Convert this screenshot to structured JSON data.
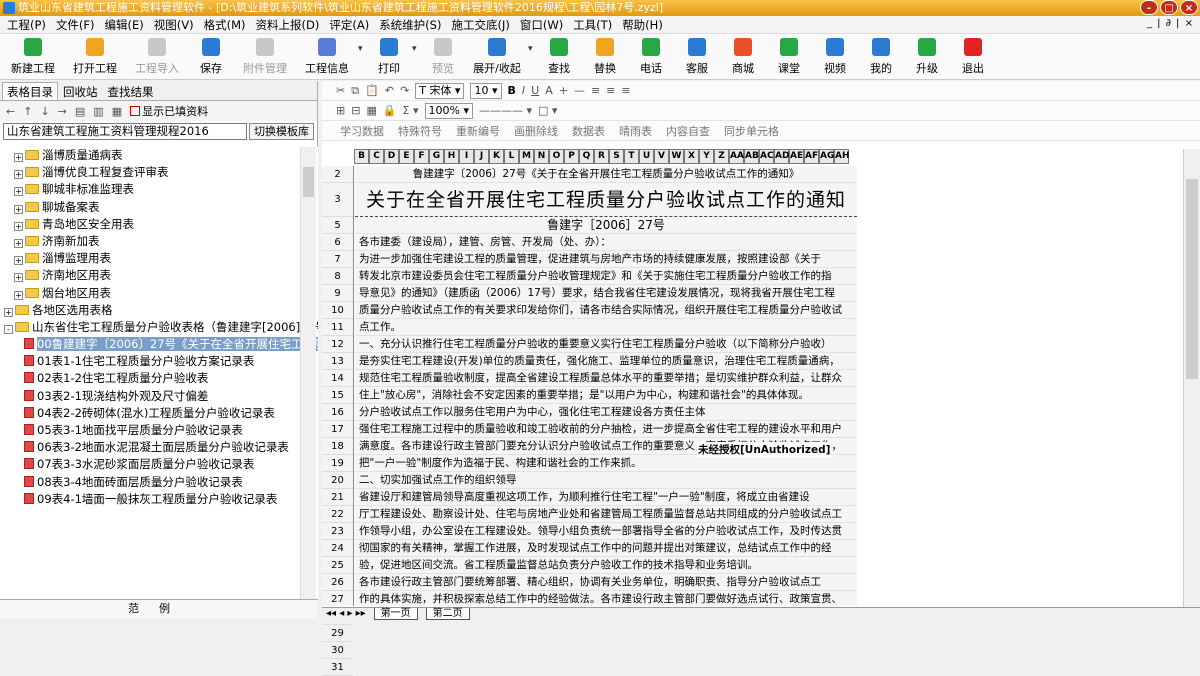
{
  "window": {
    "title": "筑业山东省建筑工程施工资料管理软件 - [D:\\筑业建筑系列软件\\筑业山东省建筑工程施工资料管理软件2016规程\\工程\\园林7号.zyzl]",
    "controls": [
      "-",
      "□",
      "×"
    ]
  },
  "menu": [
    "工程(P)",
    "文件(F)",
    "编辑(E)",
    "视图(V)",
    "格式(M)",
    "资料上报(D)",
    "评定(A)",
    "系统维护(S)",
    "施工交底(J)",
    "窗口(W)",
    "工具(T)",
    "帮助(H)"
  ],
  "mdi_controls": "_ | ∂ | ×",
  "toolbar": [
    {
      "label": "新建工程",
      "icon": "new-project-icon",
      "color": "#27a844"
    },
    {
      "label": "打开工程",
      "icon": "folder-open-icon",
      "color": "#f0a422"
    },
    {
      "label": "工程导入",
      "icon": "import-icon",
      "color": "#c8c8c8",
      "disabled": true
    },
    {
      "label": "保存",
      "icon": "save-icon",
      "color": "#2a7bd4"
    },
    {
      "label": "附件管理",
      "icon": "attachment-icon",
      "color": "#c8c8c8",
      "disabled": true
    },
    {
      "label": "工程信息",
      "icon": "info-icon",
      "color": "#5a7bd4"
    },
    {
      "label": "打印",
      "icon": "print-icon",
      "color": "#2a7bd4"
    },
    {
      "label": "预览",
      "icon": "preview-icon",
      "color": "#c8c8c8",
      "disabled": true
    },
    {
      "label": "展开/收起",
      "icon": "expand-icon",
      "color": "#2a7bd4"
    },
    {
      "label": "查找",
      "icon": "search-icon",
      "color": "#27a844"
    },
    {
      "label": "替换",
      "icon": "replace-icon",
      "color": "#f0a422"
    },
    {
      "label": "电话",
      "icon": "phone-icon",
      "color": "#27a844"
    },
    {
      "label": "客服",
      "icon": "service-icon",
      "color": "#2a7bd4"
    },
    {
      "label": "商城",
      "icon": "shop-icon",
      "color": "#e8502a"
    },
    {
      "label": "课堂",
      "icon": "classroom-icon",
      "color": "#27a844"
    },
    {
      "label": "视频",
      "icon": "video-icon",
      "color": "#2a7bd4"
    },
    {
      "label": "我的",
      "icon": "user-icon",
      "color": "#2a7bd4"
    },
    {
      "label": "升级",
      "icon": "upgrade-icon",
      "color": "#27a844"
    },
    {
      "label": "退出",
      "icon": "power-icon",
      "color": "#e02424"
    }
  ],
  "left": {
    "tabs": [
      "表格目录",
      "回收站",
      "查找结果"
    ],
    "show_filled": "显示已填资料",
    "spec": "山东省建筑工程施工资料管理规程2016",
    "switch_template": "切换模板库",
    "tree": [
      {
        "indent": 1,
        "type": "folder",
        "pm": "+",
        "text": "淄博质量通病表"
      },
      {
        "indent": 1,
        "type": "folder",
        "pm": "+",
        "text": "淄博优良工程复查评审表"
      },
      {
        "indent": 1,
        "type": "folder",
        "pm": "+",
        "text": "聊城非标准监理表"
      },
      {
        "indent": 1,
        "type": "folder",
        "pm": "+",
        "text": "聊城备案表"
      },
      {
        "indent": 1,
        "type": "folder",
        "pm": "+",
        "text": "青岛地区安全用表"
      },
      {
        "indent": 1,
        "type": "folder",
        "pm": "+",
        "text": "济南新加表"
      },
      {
        "indent": 1,
        "type": "folder",
        "pm": "+",
        "text": "淄博监理用表"
      },
      {
        "indent": 1,
        "type": "folder",
        "pm": "+",
        "text": "济南地区用表"
      },
      {
        "indent": 1,
        "type": "folder",
        "pm": "+",
        "text": "烟台地区用表"
      },
      {
        "indent": 0,
        "type": "folder",
        "pm": "+",
        "text": "各地区选用表格"
      },
      {
        "indent": 0,
        "type": "folder",
        "pm": "-",
        "text": "山东省住宅工程质量分户验收表格（鲁建建字[2006]27号）"
      },
      {
        "indent": 2,
        "type": "sheet",
        "text": "00鲁建建字〔2006〕27号《关于在全省开展住宅工程质量",
        "selected": true
      },
      {
        "indent": 2,
        "type": "sheet",
        "text": "01表1-1住宅工程质量分户验收方案记录表"
      },
      {
        "indent": 2,
        "type": "sheet",
        "text": "02表1-2住宅工程质量分户验收表"
      },
      {
        "indent": 2,
        "type": "sheet",
        "text": "03表2-1现浇结构外观及尺寸偏差"
      },
      {
        "indent": 2,
        "type": "sheet",
        "text": "04表2-2砖砌体(混水)工程质量分户验收记录表"
      },
      {
        "indent": 2,
        "type": "sheet",
        "text": "05表3-1地面找平层质量分户验收记录表"
      },
      {
        "indent": 2,
        "type": "sheet",
        "text": "06表3-2地面水泥混凝土面层质量分户验收记录表"
      },
      {
        "indent": 2,
        "type": "sheet",
        "text": "07表3-3水泥砂浆面层质量分户验收记录表"
      },
      {
        "indent": 2,
        "type": "sheet",
        "text": "08表3-4地面砖面层质量分户验收记录表"
      },
      {
        "indent": 2,
        "type": "sheet",
        "text": "09表4-1墙面一般抹灰工程质量分户验收记录表"
      }
    ],
    "example_label": "范例"
  },
  "format_toolbar": {
    "font": "宋体",
    "size": "10",
    "zoom": "100%",
    "row3": [
      "学习数据",
      "特殊符号",
      "重新编号",
      "画删除线",
      "数据表",
      "晴雨表",
      "内容自查",
      "同步单元格"
    ]
  },
  "columns": [
    "B",
    "C",
    "D",
    "E",
    "F",
    "G",
    "H",
    "I",
    "J",
    "K",
    "L",
    "M",
    "N",
    "O",
    "P",
    "Q",
    "R",
    "S",
    "T",
    "U",
    "V",
    "W",
    "X",
    "Y",
    "Z",
    "AA",
    "AB",
    "AC",
    "AD",
    "AE",
    "AF",
    "AG",
    "AH"
  ],
  "rows": [
    "2",
    "3",
    "5",
    "6",
    "7",
    "8",
    "9",
    "10",
    "11",
    "12",
    "13",
    "14",
    "15",
    "16",
    "17",
    "18",
    "19",
    "20",
    "21",
    "22",
    "23",
    "24",
    "25",
    "26",
    "27",
    "28",
    "29",
    "30",
    "31"
  ],
  "doc": {
    "header": "鲁建建字〔2006〕27号《关于在全省开展住宅工程质量分户验收试点工作的通知》",
    "title": "关于在全省开展住宅工程质量分户验收试点工作的通知",
    "docno": "鲁建字［2006］27号",
    "lines": [
      "各市建委（建设局），建管、房管、开发局（处、办）：",
      "    为进一步加强住宅建设工程的质量管理，促进建筑与房地产市场的持续健康发展，按照建设部《关于",
      "转发北京市建设委员会住宅工程质量分户验收管理规定》和《关于实施住宅工程质量分户验收工作的指",
      "导意见》的通知》（建质函（2006）17号）要求，结合我省住宅建设发展情况，现将我省开展住宅工程",
      "质量分户验收试点工作的有关要求印发给你们，请各市结合实际情况，组织开展住宅工程质量分户验收试",
      "点工作。",
      "    一、充分认识推行住宅工程质量分户验收的重要意义实行住宅工程质量分户验收（以下简称分户验收）",
      "是夯实住宅工程建设(开发)单位的质量责任，强化施工、监理单位的质量意识，治理住宅工程质量通病，",
      "规范住宅工程质量验收制度，提高全省建设工程质量总体水平的重要举措；是切实维护群众利益，让群众",
      "住上\"放心房\"，消除社会不安定因素的重要举措；是\"以用户为中心，构建和谐社会\"的具体体现。",
      "    分户验收试点工作以服务住宅用户为中心，强化住宅工程建设各方责任主体",
      "强住宅工程施工过程中的质量验收和竣工验收前的分户抽检，进一步提高全省住宅工程的建设水平和用户",
      "满意度。各市建设行政主管部门要充分认识分户验收试点工作的重要意义，高度重视分户验收试点工作，",
      "把\"一户一验\"制度作为造福于民、构建和谐社会的工作来抓。",
      "    二、切实加强试点工作的组织领导",
      "    省建设厅和建管局领导高度重视这项工作，为顺利推行住宅工程\"一户一验\"制度，将成立由省建设",
      "厅工程建设处、勘察设计处、住宅与房地产业处和省建管局工程质量监督总站共同组成的分户验收试点工",
      "作领导小组，办公室设在工程建设处。领导小组负责统一部署指导全省的分户验收试点工作，及时传达贯",
      "彻国家的有关精神，掌握工作进展，及时发现试点工作中的问题并提出对策建议，总结试点工作中的经",
      "验，促进地区间交流。省工程质量监督总站负责分户验收工作的技术指导和业务培训。",
      "    各市建设行政主管部门要统筹部署、精心组织，协调有关业务单位，明确职责、指导分户验收试点工",
      "作的具体实施，并积极探索总结工作中的经验做法。各市建设行政主管部门要做好选点试行、政策宣贯、",
      "技术支持、人员培训、效果核实工作，使住宅项目的建设(开发)单位切实履行质量责任，认真组织好分",
      "户验收工作。各级工程质量监督机构要积极参与试点的组织领导工作，尽快完善分户验收工作的技术标准，",
      "制定相应的指导意见，做好选择试点项目、进行技术培训、探索解决验收过程中的技术问题等工作。",
      "    三、扎扎实实做好分户验收试点工作"
    ],
    "unauthorized": "未经授权[UnAuthorized]"
  },
  "sheets": [
    "第一页",
    "第二页"
  ]
}
